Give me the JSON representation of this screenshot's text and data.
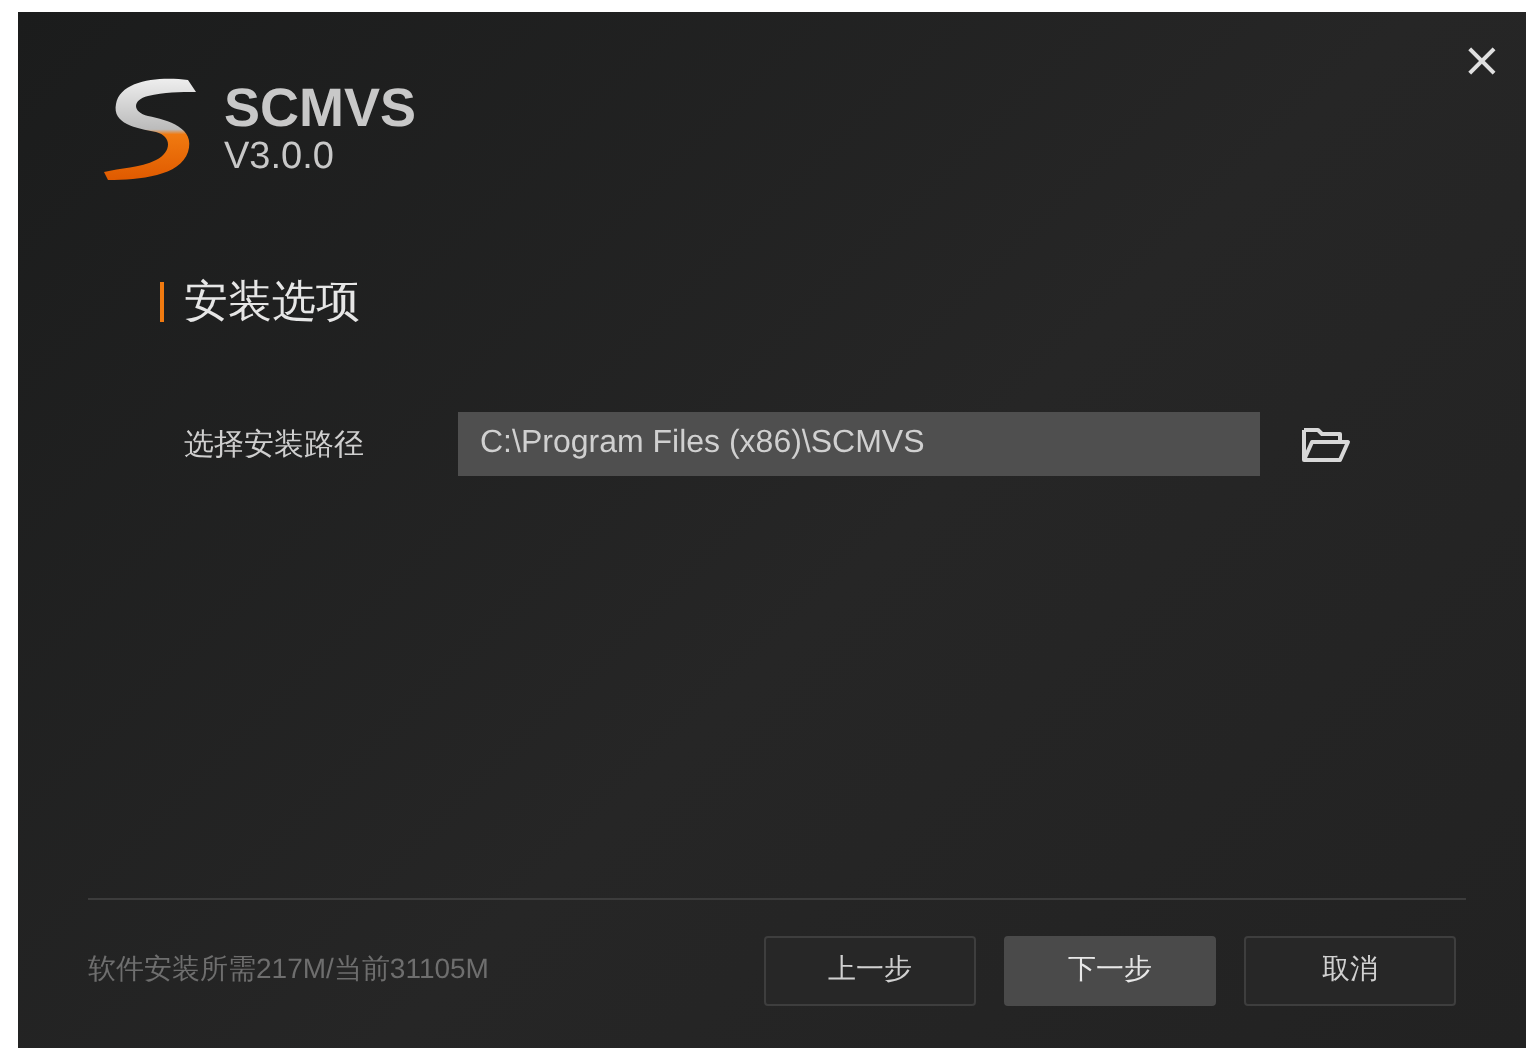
{
  "app": {
    "name": "SCMVS",
    "version": "V3.0.0"
  },
  "close": "×",
  "section_title": "安装选项",
  "install_path": {
    "label": "选择安装路径",
    "value": "C:\\Program Files (x86)\\SCMVS"
  },
  "footer": {
    "disk_info": "软件安装所需217M/当前31105M",
    "buttons": [
      {
        "label": "上一步",
        "kind": "default"
      },
      {
        "label": "下一步",
        "kind": "primary"
      },
      {
        "label": "取消",
        "kind": "default"
      }
    ]
  }
}
